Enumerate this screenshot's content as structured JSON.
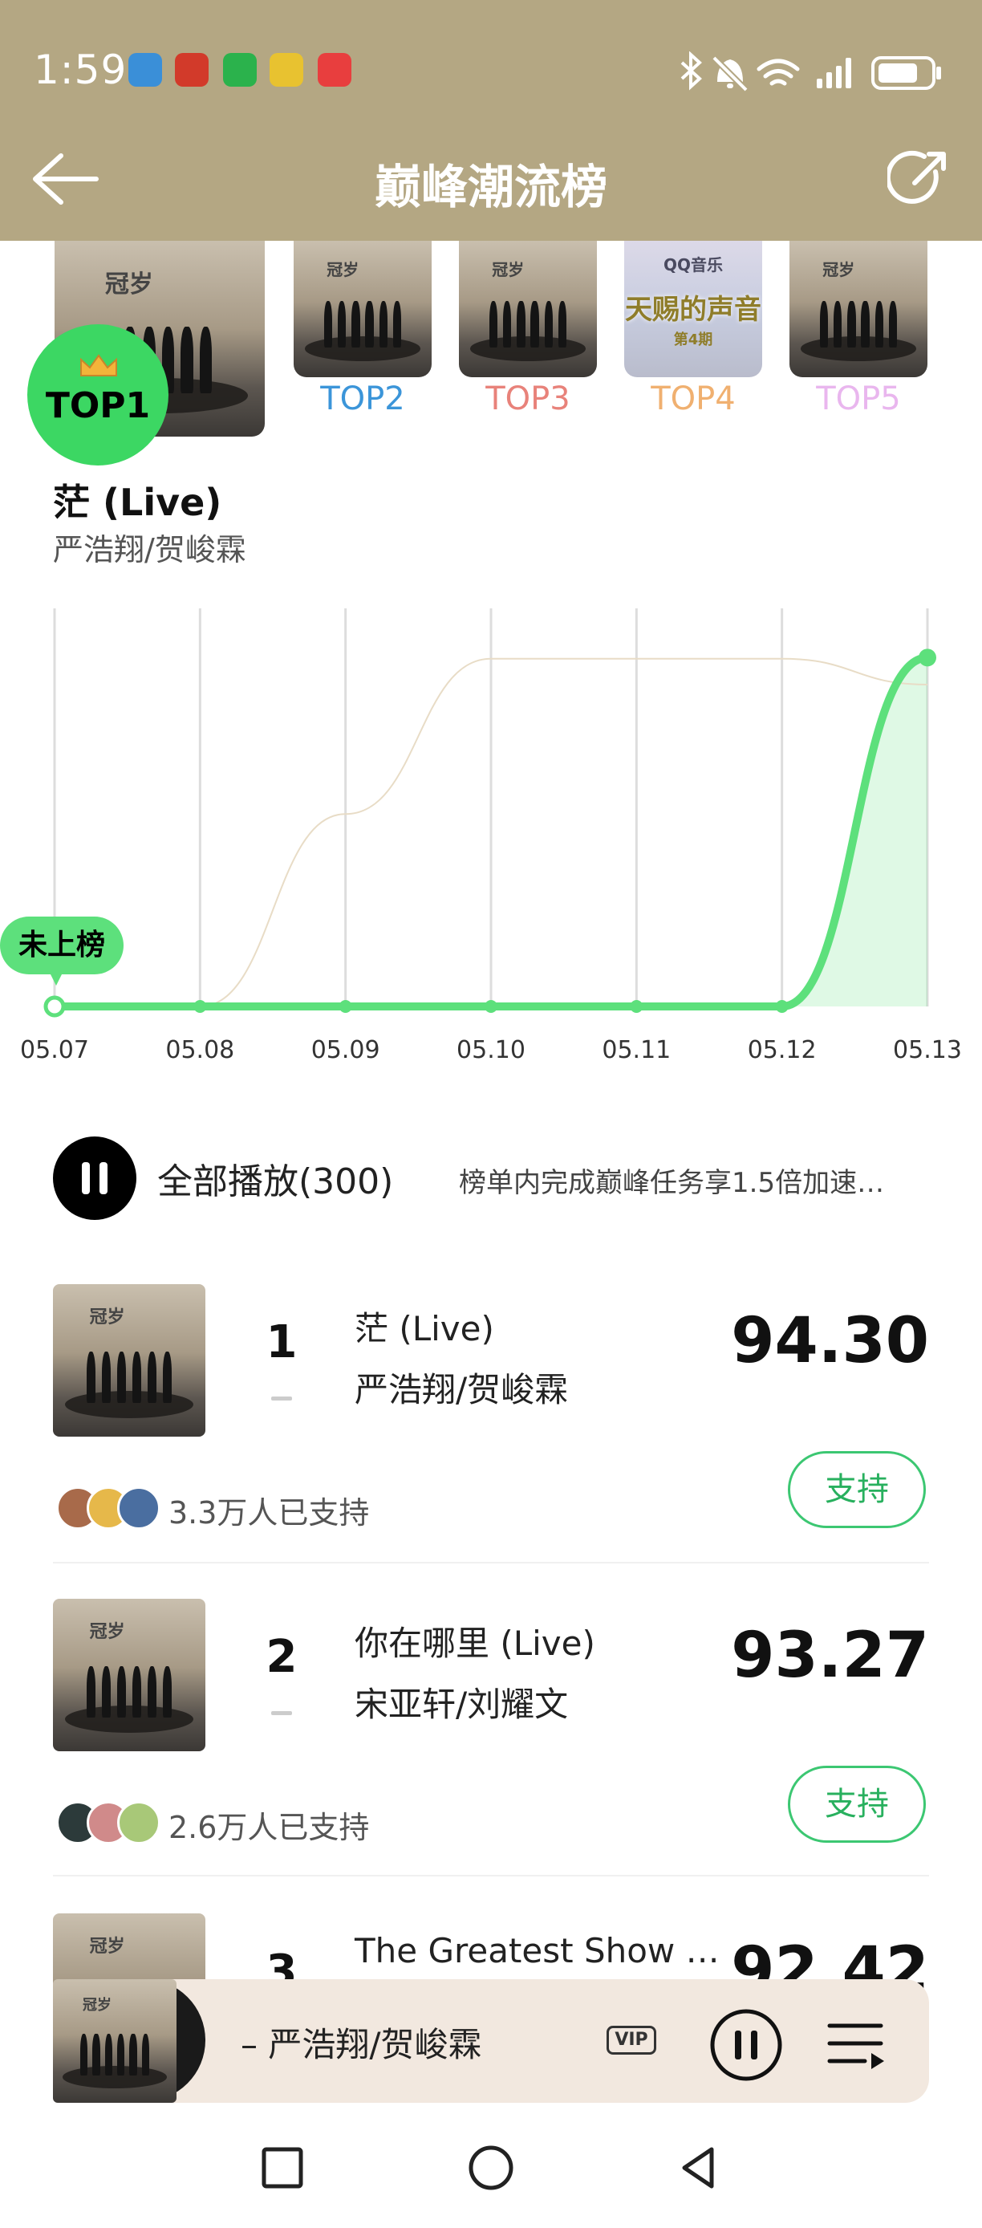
{
  "status_bar": {
    "time": "1:59",
    "app_icons": [
      "hand-app-icon",
      "game-app-icon",
      "wechat-icon",
      "weibo-icon",
      "huawei-icon"
    ],
    "app_icon_colors": [
      "#3a8fd8",
      "#d23a2a",
      "#2bb24c",
      "#e8c230",
      "#e83e3e"
    ],
    "right_icons": [
      "bluetooth-icon",
      "mute-icon",
      "wifi-icon",
      "signal-icon",
      "battery-icon"
    ]
  },
  "header": {
    "title": "巅峰潮流榜",
    "back_icon": "back-arrow-icon",
    "share_icon": "share-icon",
    "bg_color": "#b4a783"
  },
  "top_list": [
    {
      "label": "TOP1"
    },
    {
      "label": "TOP2",
      "color": "#3b95d9"
    },
    {
      "label": "TOP3",
      "color": "#e8827a"
    },
    {
      "label": "TOP4",
      "color": "#f0b070"
    },
    {
      "label": "TOP5",
      "color": "#e9b6ee"
    }
  ],
  "cover_text": {
    "album": "冠岁",
    "qq": "QQ音乐",
    "show": "天赐的声音",
    "episode": "第4期"
  },
  "featured": {
    "title": "茫 (Live)",
    "artist": "严浩翔/贺峻霖"
  },
  "chart_data": {
    "type": "line",
    "x": [
      "05.07",
      "05.08",
      "05.09",
      "05.10",
      "05.11",
      "05.12",
      "05.13"
    ],
    "series": [
      {
        "values": [
          0,
          0,
          0,
          0,
          0,
          0,
          94.3
        ],
        "color": "#5de07c"
      },
      {
        "values": [
          0,
          0,
          52,
          94,
          94,
          94,
          87
        ],
        "color": "#e8dcc6"
      }
    ],
    "annotations": [
      {
        "x": "05.07",
        "text": "未上榜"
      }
    ],
    "ylim": [
      0,
      105
    ],
    "grid": "vertical lines at each date",
    "legend": "none"
  },
  "play_all": {
    "label": "全部播放(300)",
    "promo": "榜单内完成巅峰任务享1.5倍加速…",
    "icon": "pause-icon"
  },
  "rows": [
    {
      "rank": "1",
      "title": "茫 (Live)",
      "artist": "严浩翔/贺峻霖",
      "score": "94.30",
      "supporters": "3.3万人已支持",
      "support_label": "支持",
      "avatar_colors": [
        "#a86a4a",
        "#e6b84a",
        "#4a6ea0"
      ]
    },
    {
      "rank": "2",
      "title": "你在哪里 (Live)",
      "artist": "宋亚轩/刘耀文",
      "score": "93.27",
      "supporters": "2.6万人已支持",
      "support_label": "支持",
      "avatar_colors": [
        "#2c3a3a",
        "#d08a8a",
        "#a8c878"
      ]
    },
    {
      "rank": "3",
      "title": "The Greatest Show …",
      "artist": "",
      "score": "92.42"
    }
  ],
  "mini_player": {
    "artist": "– 严浩翔/贺峻霖",
    "vip": "VIP"
  },
  "nav": [
    "recent-apps-icon",
    "home-icon",
    "back-icon"
  ]
}
